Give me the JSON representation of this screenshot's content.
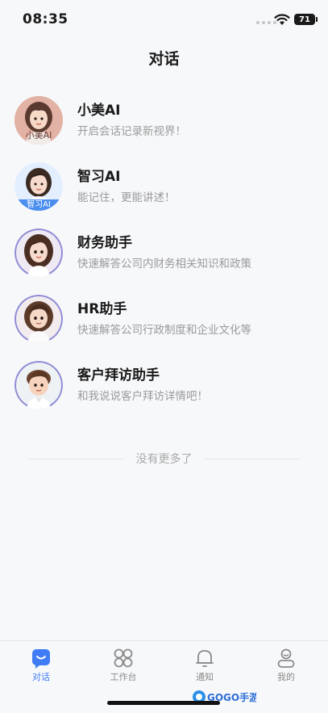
{
  "status_bar": {
    "time": "08:35",
    "battery": "71"
  },
  "header": {
    "title": "对话"
  },
  "conversations": [
    {
      "name": "小美AI",
      "desc": "开启会话记录新视界！",
      "badge": "小美AI"
    },
    {
      "name": "智习AI",
      "desc": "能记住，更能讲述！",
      "badge": "智习AI"
    },
    {
      "name": "财务助手",
      "desc": "快速解答公司内财务相关知识和政策"
    },
    {
      "name": "HR助手",
      "desc": "快速解答公司行政制度和企业文化等"
    },
    {
      "name": "客户拜访助手",
      "desc": "和我说说客户拜访详情吧！"
    }
  ],
  "end_text": "没有更多了",
  "tabs": [
    {
      "label": "对话",
      "icon": "chat-icon",
      "active": true
    },
    {
      "label": "工作台",
      "icon": "grid-icon",
      "active": false
    },
    {
      "label": "通知",
      "icon": "bell-icon",
      "active": false
    },
    {
      "label": "我的",
      "icon": "user-icon",
      "active": false
    }
  ],
  "watermark": {
    "text": "GOGO手游网"
  },
  "colors": {
    "accent": "#3f7cf5",
    "background": "#f7f8fa",
    "secondary_text": "#9a9a9a"
  }
}
